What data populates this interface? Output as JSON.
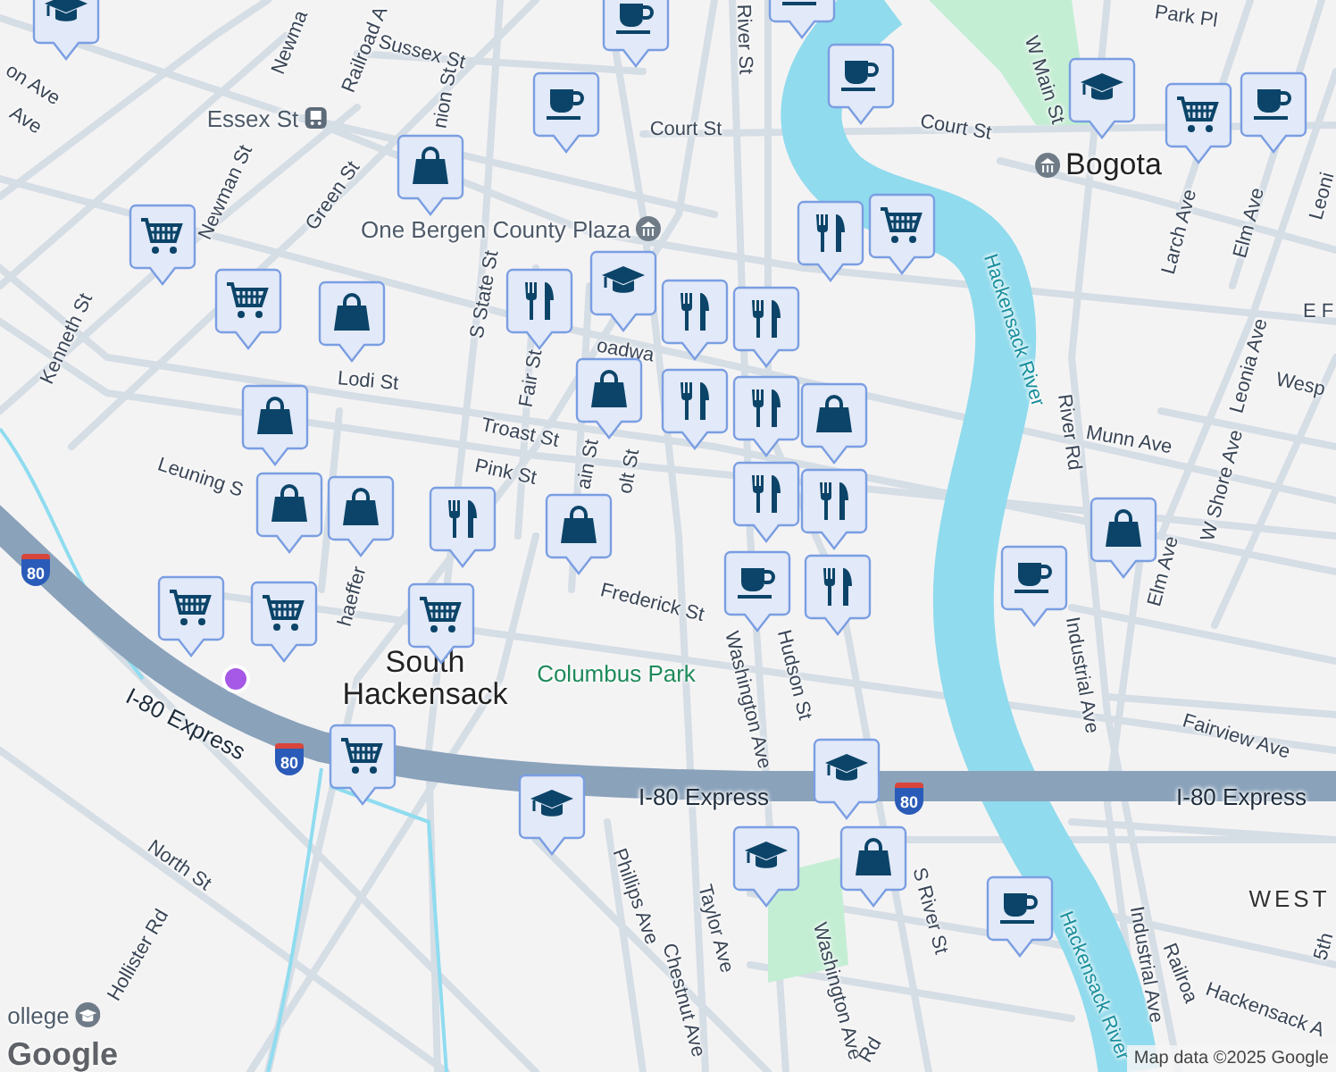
{
  "map": {
    "labels": [
      {
        "text": "on Ave",
        "kind": "street"
      },
      {
        "text": "Ave",
        "kind": "street"
      },
      {
        "text": "Newma",
        "kind": "street"
      },
      {
        "text": "Railroad A",
        "kind": "street"
      },
      {
        "text": "Sussex St",
        "kind": "street"
      },
      {
        "text": "Essex St",
        "kind": "station"
      },
      {
        "text": "nion St",
        "kind": "street"
      },
      {
        "text": "River St",
        "kind": "street"
      },
      {
        "text": "Court St",
        "kind": "street"
      },
      {
        "text": "Court St",
        "kind": "street"
      },
      {
        "text": "W Main St",
        "kind": "street"
      },
      {
        "text": "Park Pl",
        "kind": "street"
      },
      {
        "text": "Bogota",
        "kind": "town_poi"
      },
      {
        "text": "Newman St",
        "kind": "street"
      },
      {
        "text": "Green St",
        "kind": "street"
      },
      {
        "text": "One Bergen County Plaza",
        "kind": "landmark"
      },
      {
        "text": "Kenneth St",
        "kind": "street"
      },
      {
        "text": "S State St",
        "kind": "street"
      },
      {
        "text": "Fair St",
        "kind": "street"
      },
      {
        "text": "Lodi St",
        "kind": "street"
      },
      {
        "text": "oadwa",
        "kind": "street"
      },
      {
        "text": "Troast St",
        "kind": "street"
      },
      {
        "text": "Pink St",
        "kind": "street"
      },
      {
        "text": "ain St",
        "kind": "street"
      },
      {
        "text": "olt St",
        "kind": "street"
      },
      {
        "text": "Leuning S",
        "kind": "street"
      },
      {
        "text": "haeffer",
        "kind": "street"
      },
      {
        "text": "Frederick St",
        "kind": "street"
      },
      {
        "text": "Washington Ave",
        "kind": "street"
      },
      {
        "text": "Hudson St",
        "kind": "street"
      },
      {
        "text": "Columbus Park",
        "kind": "park"
      },
      {
        "text": "South Hackensack",
        "kind": "town"
      },
      {
        "text": "Larch Ave",
        "kind": "street"
      },
      {
        "text": "Elm Ave",
        "kind": "street"
      },
      {
        "text": "Leoni",
        "kind": "street"
      },
      {
        "text": "E F",
        "kind": "street"
      },
      {
        "text": "Leonia Ave",
        "kind": "street"
      },
      {
        "text": "Wesp",
        "kind": "street"
      },
      {
        "text": "Hackensack River",
        "kind": "water"
      },
      {
        "text": "River Rd",
        "kind": "street"
      },
      {
        "text": "Munn Ave",
        "kind": "street"
      },
      {
        "text": "W Shore Ave",
        "kind": "street"
      },
      {
        "text": "Elm Ave",
        "kind": "street"
      },
      {
        "text": "Industrial Ave",
        "kind": "street"
      },
      {
        "text": "Fairview Ave",
        "kind": "street"
      },
      {
        "text": "I-80 Express",
        "kind": "highway"
      },
      {
        "text": "I-80 Express",
        "kind": "highway"
      },
      {
        "text": "I-80 Express",
        "kind": "highway"
      },
      {
        "text": "North St",
        "kind": "street"
      },
      {
        "text": "Phillips Ave",
        "kind": "street"
      },
      {
        "text": "Taylor Ave",
        "kind": "street"
      },
      {
        "text": "Chestnut Ave",
        "kind": "street"
      },
      {
        "text": "Washington Ave",
        "kind": "street"
      },
      {
        "text": "S River St",
        "kind": "street"
      },
      {
        "text": "Hackensack River",
        "kind": "water"
      },
      {
        "text": "Industrial Ave",
        "kind": "street"
      },
      {
        "text": "WEST",
        "kind": "area"
      },
      {
        "text": "5th",
        "kind": "street"
      },
      {
        "text": "Railroa",
        "kind": "street"
      },
      {
        "text": "Hackensack A",
        "kind": "street"
      },
      {
        "text": "Hollister Rd",
        "kind": "street"
      },
      {
        "text": "ollege",
        "kind": "college"
      },
      {
        "text": "Rd",
        "kind": "street"
      }
    ],
    "shields": [
      {
        "number": "80"
      },
      {
        "number": "80"
      },
      {
        "number": "80"
      }
    ],
    "pins": [
      {
        "kind": "school"
      },
      {
        "kind": "coffee"
      },
      {
        "kind": "coffee"
      },
      {
        "kind": "coffee"
      },
      {
        "kind": "coffee"
      },
      {
        "kind": "school"
      },
      {
        "kind": "coffee"
      },
      {
        "kind": "cart"
      },
      {
        "kind": "shop"
      },
      {
        "kind": "cart"
      },
      {
        "kind": "cart"
      },
      {
        "kind": "food"
      },
      {
        "kind": "cart"
      },
      {
        "kind": "shop"
      },
      {
        "kind": "food"
      },
      {
        "kind": "food"
      },
      {
        "kind": "school"
      },
      {
        "kind": "food"
      },
      {
        "kind": "shop"
      },
      {
        "kind": "food"
      },
      {
        "kind": "food"
      },
      {
        "kind": "food"
      },
      {
        "kind": "shop"
      },
      {
        "kind": "shop"
      },
      {
        "kind": "shop"
      },
      {
        "kind": "shop"
      },
      {
        "kind": "food"
      },
      {
        "kind": "shop"
      },
      {
        "kind": "food"
      },
      {
        "kind": "food"
      },
      {
        "kind": "coffee"
      },
      {
        "kind": "coffee"
      },
      {
        "kind": "shop"
      },
      {
        "kind": "cart"
      },
      {
        "kind": "cart"
      },
      {
        "kind": "cart"
      },
      {
        "kind": "cart"
      },
      {
        "kind": "school"
      },
      {
        "kind": "school"
      },
      {
        "kind": "school"
      },
      {
        "kind": "shop"
      },
      {
        "kind": "coffee"
      }
    ]
  },
  "logo": "Google",
  "attribution": "Map data ©2025 Google"
}
